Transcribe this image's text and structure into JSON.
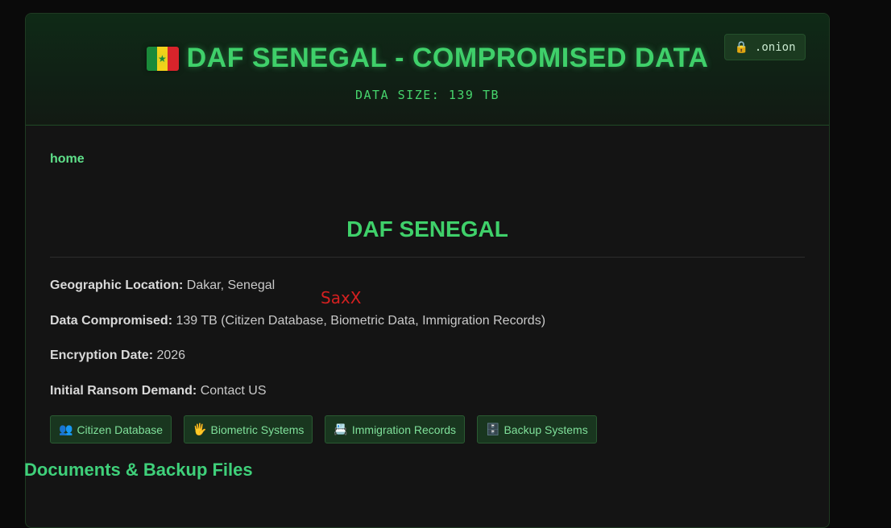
{
  "header": {
    "title": "DAF SENEGAL - COMPROMISED DATA",
    "data_size": "DATA SIZE: 139 TB",
    "onion_badge": ".onion",
    "flag_icon": "senegal-flag-icon"
  },
  "nav": {
    "home": "home"
  },
  "entry": {
    "title": "DAF SENEGAL",
    "location_label": "Geographic Location:",
    "location_value": "Dakar, Senegal",
    "data_label": "Data Compromised:",
    "data_value": "139 TB (Citizen Database, Biometric Data, Immigration Records)",
    "encryption_label": "Encryption Date:",
    "encryption_value": "2026",
    "ransom_label": "Initial Ransom Demand:",
    "ransom_value": "Contact US"
  },
  "watermark": "SaxX",
  "tags": [
    {
      "icon": "👥",
      "label": "Citizen Database"
    },
    {
      "icon": "🖐",
      "label": "Biometric Systems"
    },
    {
      "icon": "📇",
      "label": "Immigration Records"
    },
    {
      "icon": "🗄️",
      "label": "Backup Systems"
    }
  ],
  "documents": {
    "title": "Documents & Backup Files"
  },
  "colors": {
    "accent": "#3fd06a",
    "background": "#0a0a0a",
    "panel": "#141414",
    "watermark": "#d42020"
  }
}
